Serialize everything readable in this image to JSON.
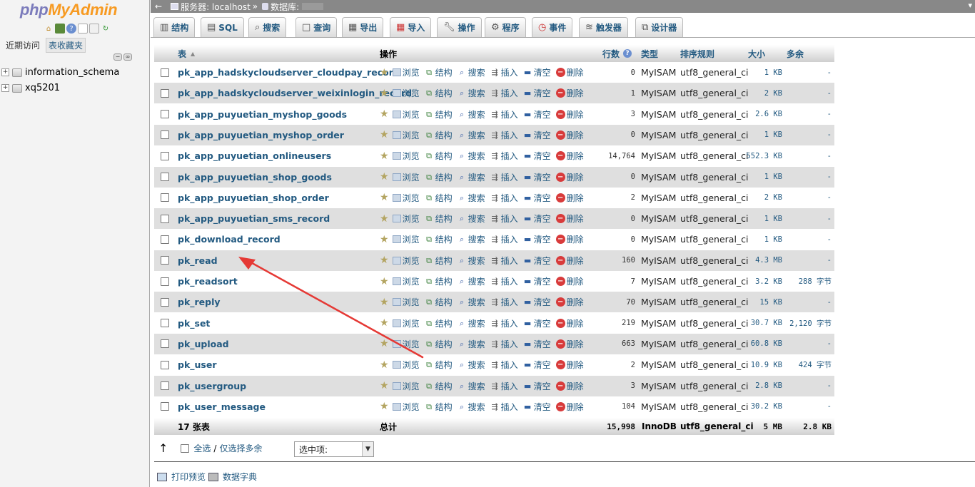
{
  "logo": {
    "part1": "php",
    "part2": "MyAdmin"
  },
  "nav": {
    "tabs": [
      "近期访问",
      "表收藏夹"
    ],
    "tree": [
      {
        "label": "information_schema"
      },
      {
        "label": "xq5201"
      }
    ]
  },
  "topbar": {
    "back": "←",
    "server_label": "服务器: localhost",
    "sep": "»",
    "db_label": "数据库:"
  },
  "menu": {
    "tabs": [
      {
        "label": "结构",
        "icon": "structure-icon"
      },
      {
        "label": "SQL",
        "icon": "sql-icon"
      },
      {
        "label": "搜索",
        "icon": "search-icon"
      },
      {
        "label": "查询",
        "icon": "query-icon"
      },
      {
        "label": "导出",
        "icon": "export-icon"
      },
      {
        "label": "导入",
        "icon": "import-icon"
      },
      {
        "label": "操作",
        "icon": "wrench-icon"
      },
      {
        "label": "程序",
        "icon": "routines-icon"
      },
      {
        "label": "事件",
        "icon": "clock-icon"
      },
      {
        "label": "触发器",
        "icon": "trigger-icon"
      },
      {
        "label": "设计器",
        "icon": "designer-icon"
      }
    ]
  },
  "table": {
    "headers": {
      "table": "表",
      "sort_indicator": "▲",
      "action": "操作",
      "rows": "行数",
      "help": "?",
      "type": "类型",
      "collation": "排序规则",
      "size": "大小",
      "overhead": "多余"
    },
    "action_labels": {
      "browse": "浏览",
      "structure": "结构",
      "search": "搜索",
      "insert": "插入",
      "empty": "清空",
      "drop": "删除"
    },
    "rows": [
      {
        "name": "pk_app_hadskycloudserver_cloudpay_record",
        "rows": "0",
        "engine": "MyISAM",
        "collation": "utf8_general_ci",
        "size": "1 KB",
        "overhead": "-"
      },
      {
        "name": "pk_app_hadskycloudserver_weixinlogin_record",
        "rows": "1",
        "engine": "MyISAM",
        "collation": "utf8_general_ci",
        "size": "2 KB",
        "overhead": "-"
      },
      {
        "name": "pk_app_puyuetian_myshop_goods",
        "rows": "3",
        "engine": "MyISAM",
        "collation": "utf8_general_ci",
        "size": "2.6 KB",
        "overhead": "-"
      },
      {
        "name": "pk_app_puyuetian_myshop_order",
        "rows": "0",
        "engine": "MyISAM",
        "collation": "utf8_general_ci",
        "size": "1 KB",
        "overhead": "-"
      },
      {
        "name": "pk_app_puyuetian_onlineusers",
        "rows": "14,764",
        "engine": "MyISAM",
        "collation": "utf8_general_ci",
        "size": "552.3 KB",
        "overhead": "-"
      },
      {
        "name": "pk_app_puyuetian_shop_goods",
        "rows": "0",
        "engine": "MyISAM",
        "collation": "utf8_general_ci",
        "size": "1 KB",
        "overhead": "-"
      },
      {
        "name": "pk_app_puyuetian_shop_order",
        "rows": "2",
        "engine": "MyISAM",
        "collation": "utf8_general_ci",
        "size": "2 KB",
        "overhead": "-"
      },
      {
        "name": "pk_app_puyuetian_sms_record",
        "rows": "0",
        "engine": "MyISAM",
        "collation": "utf8_general_ci",
        "size": "1 KB",
        "overhead": "-"
      },
      {
        "name": "pk_download_record",
        "rows": "0",
        "engine": "MyISAM",
        "collation": "utf8_general_ci",
        "size": "1 KB",
        "overhead": "-"
      },
      {
        "name": "pk_read",
        "rows": "160",
        "engine": "MyISAM",
        "collation": "utf8_general_ci",
        "size": "4.3 MB",
        "overhead": "-"
      },
      {
        "name": "pk_readsort",
        "rows": "7",
        "engine": "MyISAM",
        "collation": "utf8_general_ci",
        "size": "3.2 KB",
        "overhead": "288 字节"
      },
      {
        "name": "pk_reply",
        "rows": "70",
        "engine": "MyISAM",
        "collation": "utf8_general_ci",
        "size": "15 KB",
        "overhead": "-"
      },
      {
        "name": "pk_set",
        "rows": "219",
        "engine": "MyISAM",
        "collation": "utf8_general_ci",
        "size": "30.7 KB",
        "overhead": "2,120 字节"
      },
      {
        "name": "pk_upload",
        "rows": "663",
        "engine": "MyISAM",
        "collation": "utf8_general_ci",
        "size": "60.8 KB",
        "overhead": "-"
      },
      {
        "name": "pk_user",
        "rows": "2",
        "engine": "MyISAM",
        "collation": "utf8_general_ci",
        "size": "10.9 KB",
        "overhead": "424 字节"
      },
      {
        "name": "pk_usergroup",
        "rows": "3",
        "engine": "MyISAM",
        "collation": "utf8_general_ci",
        "size": "2.8 KB",
        "overhead": "-"
      },
      {
        "name": "pk_user_message",
        "rows": "104",
        "engine": "MyISAM",
        "collation": "utf8_general_ci",
        "size": "30.2 KB",
        "overhead": "-"
      }
    ],
    "footer": {
      "count": "17 张表",
      "total_label": "总计",
      "rows": "15,998",
      "engine": "InnoDB",
      "collation": "utf8_general_ci",
      "size": "5 MB",
      "overhead": "2.8 KB"
    }
  },
  "bulk": {
    "arrow": "↑",
    "check_all": "全选",
    "sep": "/",
    "check_overhead": "仅选择多余",
    "with_selected": "选中项:"
  },
  "bottom": {
    "print_view": "打印预览",
    "data_dictionary": "数据字典"
  },
  "colors": {
    "link": "#235a81",
    "annotation_arrow": "#e53935",
    "row_alt": "#dfdfdf"
  }
}
